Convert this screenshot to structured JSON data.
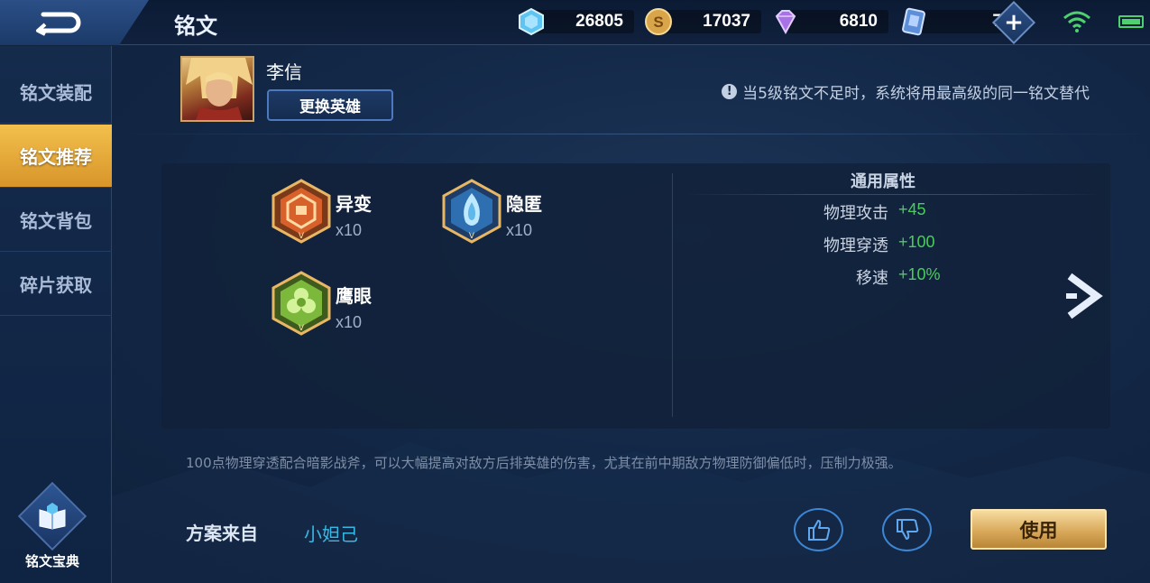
{
  "header": {
    "title": "铭文",
    "currencies": [
      {
        "icon": "crystal-icon",
        "value": "26805"
      },
      {
        "icon": "gold-coin-icon",
        "value": "17037"
      },
      {
        "icon": "diamond-icon",
        "value": "6810"
      },
      {
        "icon": "voucher-icon",
        "value": "7"
      }
    ]
  },
  "sidebar": {
    "items": [
      {
        "label": "铭文装配",
        "active": false
      },
      {
        "label": "铭文推荐",
        "active": true
      },
      {
        "label": "铭文背包",
        "active": false
      },
      {
        "label": "碎片获取",
        "active": false
      }
    ],
    "codex_label": "铭文宝典"
  },
  "hero": {
    "name": "李信",
    "change_label": "更换英雄"
  },
  "notice": "当5级铭文不足时，系统将用最高级的同一铭文替代",
  "runes": [
    {
      "name": "异变",
      "count": "x10",
      "color": "#d7602a"
    },
    {
      "name": "隐匿",
      "count": "x10",
      "color": "#3a8fd0"
    },
    {
      "name": "鹰眼",
      "count": "x10",
      "color": "#6ab53a"
    }
  ],
  "attributes": {
    "title": "通用属性",
    "rows": [
      {
        "label": "物理攻击",
        "value": "+45"
      },
      {
        "label": "物理穿透",
        "value": "+100"
      },
      {
        "label": "移速",
        "value": "+10%"
      }
    ]
  },
  "description": "100点物理穿透配合暗影战斧，可以大幅提高对敌方后排英雄的伤害，尤其在前中期敌方物理防御偏低时，压制力极强。",
  "source": {
    "label": "方案来自",
    "author": "小妲己"
  },
  "actions": {
    "use_label": "使用"
  },
  "colors": {
    "accent_gold": "#e3b25a",
    "positive_green": "#4ccb5d",
    "author_blue": "#37b9e6"
  }
}
